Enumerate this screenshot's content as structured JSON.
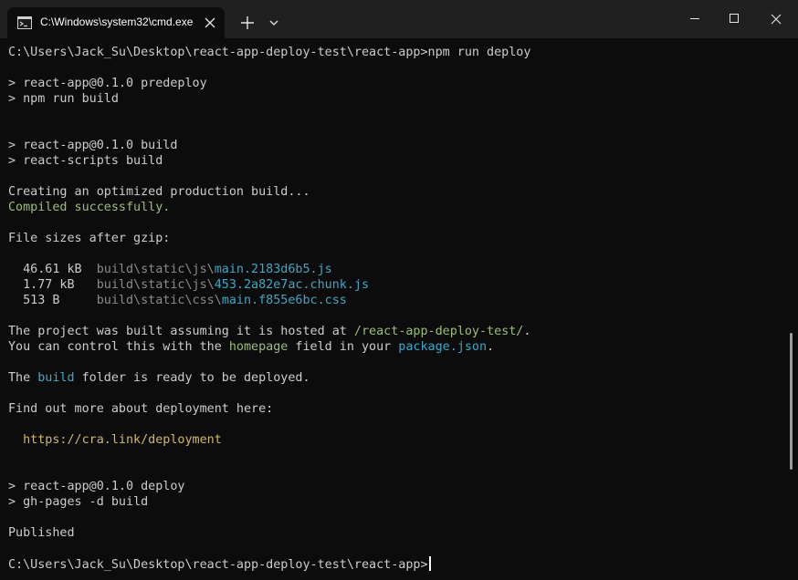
{
  "titlebar": {
    "tab_title": "C:\\Windows\\system32\\cmd.exe",
    "tab_icon": "cmd-terminal-icon",
    "buttons": [
      "close-icon",
      "plus-icon",
      "chevron-down-icon",
      "minimize-icon",
      "maximize-icon",
      "close-icon"
    ]
  },
  "colors": {
    "background": "#0c0c0c",
    "titlebar": "#202020",
    "text": "#cccccc",
    "success_green": "#9bbd7a",
    "path_gray": "#8a8a8a",
    "highlight_cyan": "#3ea8c8",
    "url_yellow": "#cdb86e"
  },
  "terminal": {
    "cmd_prompt_1": "C:\\Users\\Jack_Su\\Desktop\\react-app-deploy-test\\react-app>npm run deploy",
    "predeploy_1": "> react-app@0.1.0 predeploy",
    "predeploy_2": "> npm run build",
    "build_1": "> react-app@0.1.0 build",
    "build_2": "> react-scripts build",
    "creating": "Creating an optimized production build...",
    "compiled": "Compiled successfully.",
    "sizes_header": "File sizes after gzip:",
    "files": [
      {
        "size": "  46.61 kB  ",
        "dir": "build\\static\\js\\",
        "name": "main.2183d6b5.js"
      },
      {
        "size": "  1.77 kB   ",
        "dir": "build\\static\\js\\",
        "name": "453.2a82e7ac.chunk.js"
      },
      {
        "size": "  513 B     ",
        "dir": "build\\static\\css\\",
        "name": "main.f855e6bc.css"
      }
    ],
    "hosted_pre": "The project was built assuming it is hosted at ",
    "hosted_path": "/react-app-deploy-test/",
    "hosted_post": ".",
    "control_pre": "You can control this with the ",
    "control_homepage": "homepage",
    "control_mid": " field in your ",
    "control_pkg": "package.json",
    "control_post": ".",
    "folder_pre": "The ",
    "folder_build": "build",
    "folder_post": " folder is ready to be deployed.",
    "find_out": "Find out more about deployment here:",
    "deploy_url": "  https://cra.link/deployment",
    "deploy_1": "> react-app@0.1.0 deploy",
    "deploy_2": "> gh-pages -d build",
    "published": "Published",
    "cmd_prompt_2": "C:\\Users\\Jack_Su\\Desktop\\react-app-deploy-test\\react-app>"
  }
}
